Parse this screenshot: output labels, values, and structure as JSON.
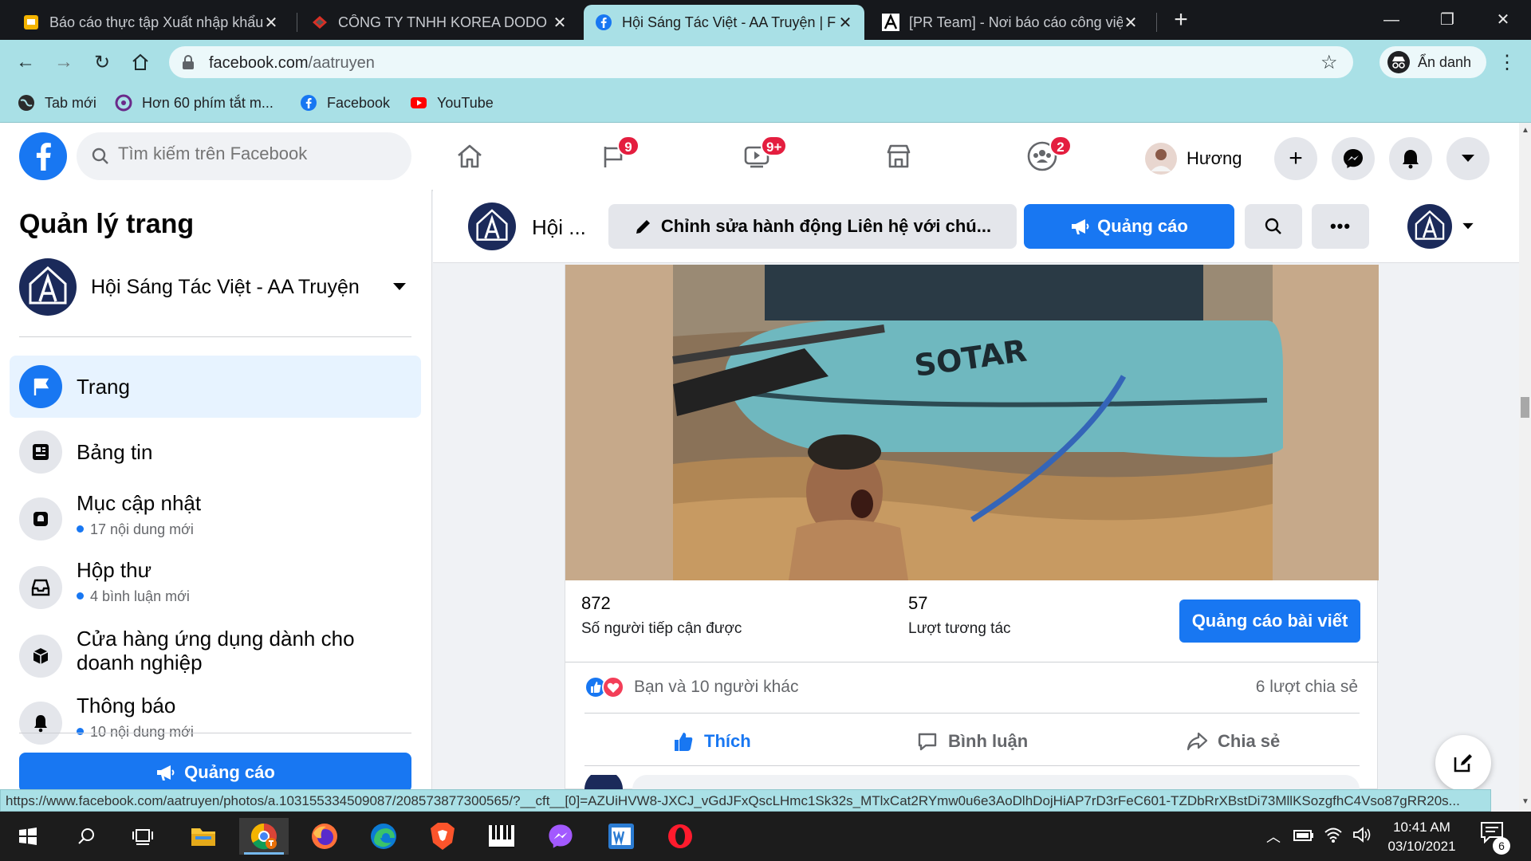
{
  "browser": {
    "tabs": [
      {
        "label": "Báo cáo thực tập Xuất nhập khẩu",
        "active": false
      },
      {
        "label": "CÔNG TY TNHH KOREA DODO D",
        "active": false
      },
      {
        "label": "Hội Sáng Tác Việt - AA Truyện | F",
        "active": true
      },
      {
        "label": "[PR Team] - Nơi báo cáo công việ",
        "active": false
      }
    ],
    "url_host": "facebook.com",
    "url_path": "/aatruyen",
    "incognito_label": "Ẩn danh",
    "bookmarks": [
      "Tab mới",
      "Hơn 60 phím tắt m...",
      "Facebook",
      "YouTube"
    ],
    "status_url": "https://www.facebook.com/aatruyen/photos/a.103155334509087/208573877300565/?__cft__[0]=AZUiHVW8-JXCJ_vGdJFxQscLHmc1Sk32s_MTlxCat2RYmw0u6e3AoDlhDojHiAP7rD3rFeC601-TZDbRrXBstDi73MllKSozgfhC4Vso87gRR20s..."
  },
  "fb": {
    "search_placeholder": "Tìm kiếm trên Facebook",
    "badges": {
      "pages": "9",
      "watch": "9+",
      "groups": "2"
    },
    "user_name": "Hương",
    "colors": {
      "brand": "#1877f2",
      "badge": "#e41e3f"
    }
  },
  "sidebar": {
    "title": "Quản lý trang",
    "page_name": "Hội Sáng Tác Việt - AA Truyện",
    "items": [
      {
        "label": "Trang",
        "sub": ""
      },
      {
        "label": "Bảng tin",
        "sub": ""
      },
      {
        "label": "Mục cập nhật",
        "sub": "17 nội dung mới"
      },
      {
        "label": "Hộp thư",
        "sub": "4 bình luận mới"
      },
      {
        "label": "Cửa hàng ứng dụng dành cho",
        "label2": "doanh nghiệp",
        "sub": ""
      },
      {
        "label": "Thông báo",
        "sub": "10 nội dung mới"
      }
    ],
    "ad_button": "Quảng cáo"
  },
  "pagebar": {
    "page_short": "Hội ...",
    "edit_contact": "Chỉnh sửa hành động Liên hệ với chú...",
    "ad_button": "Quảng cáo"
  },
  "post": {
    "boat_text": "SOTAR",
    "reach_num": "872",
    "reach_label": "Số người tiếp cận được",
    "engage_num": "57",
    "engage_label": "Lượt tương tác",
    "boost_button": "Quảng cáo bài viết",
    "reactions_text": "Bạn và 10 người khác",
    "shares_text": "6 lượt chia sẻ",
    "like": "Thích",
    "comment": "Bình luận",
    "share": "Chia sẻ"
  },
  "taskbar": {
    "time": "10:41 AM",
    "date": "03/10/2021",
    "notif_count": "6"
  }
}
